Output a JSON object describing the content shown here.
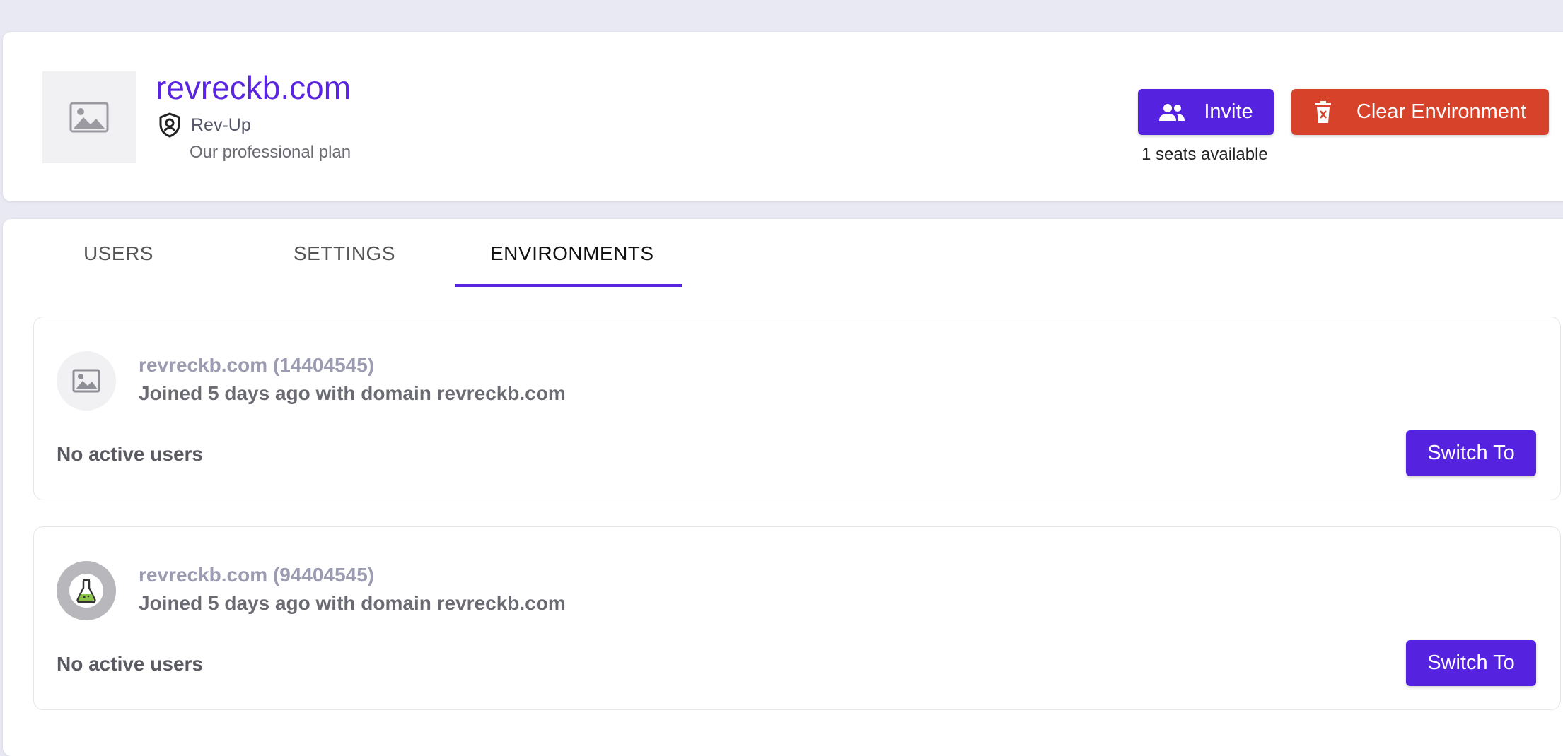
{
  "org": {
    "name": "revreckb.com",
    "plan_name": "Rev-Up",
    "plan_desc": "Our professional plan"
  },
  "actions": {
    "invite_label": "Invite",
    "clear_label": "Clear Environment",
    "seats_text": "1 seats available"
  },
  "tabs": [
    {
      "label": "USERS"
    },
    {
      "label": "SETTINGS"
    },
    {
      "label": "ENVIRONMENTS"
    }
  ],
  "environments": [
    {
      "title": "revreckb.com (14404545)",
      "subtitle": "Joined 5 days ago with domain revreckb.com",
      "users_text": "No active users",
      "switch_label": "Switch To",
      "icon": "image-placeholder-icon"
    },
    {
      "title": "revreckb.com (94404545)",
      "subtitle": "Joined 5 days ago with domain revreckb.com",
      "users_text": "No active users",
      "switch_label": "Switch To",
      "icon": "flask-icon"
    }
  ],
  "colors": {
    "accent": "#5523e0",
    "danger": "#d6432a",
    "background": "#e9e9f3"
  }
}
